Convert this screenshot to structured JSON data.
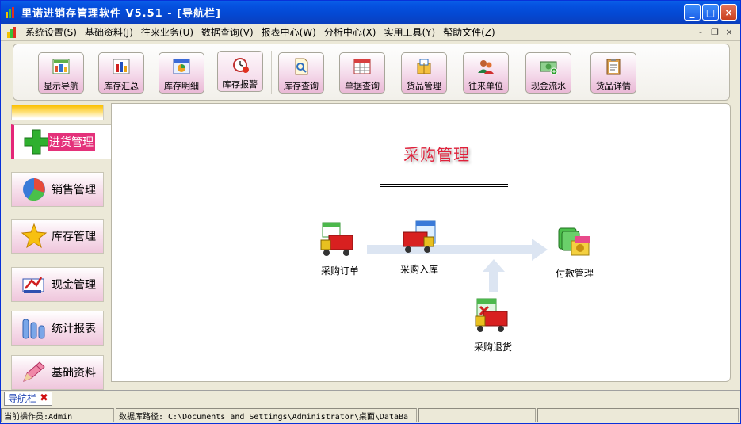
{
  "window": {
    "title": "里诺进销存管理软件 V5.51 - [导航栏]",
    "controls": {
      "minimize": "_",
      "maximize": "□",
      "close": "×"
    }
  },
  "menu": {
    "items": [
      "系统设置(S)",
      "基础资料(J)",
      "往来业务(U)",
      "数据查询(V)",
      "报表中心(W)",
      "分析中心(X)",
      "实用工具(Y)",
      "帮助文件(Z)"
    ],
    "mdi_controls": [
      "-",
      "❐",
      "×"
    ]
  },
  "toolbar": {
    "buttons": [
      {
        "label": "显示导航",
        "icon": "grid-chart-icon"
      },
      {
        "label": "库存汇总",
        "icon": "bar-chart-icon"
      },
      {
        "label": "库存明细",
        "icon": "pie-window-icon"
      },
      {
        "label": "库存报警",
        "icon": "alarm-clock-icon"
      },
      {
        "label": "库存查询",
        "icon": "search-doc-icon"
      },
      {
        "label": "单据查询",
        "icon": "table-icon"
      },
      {
        "label": "货品管理",
        "icon": "package-icon"
      },
      {
        "label": "往来单位",
        "icon": "people-icon"
      },
      {
        "label": "现金流水",
        "icon": "cash-icon"
      },
      {
        "label": "货品详情",
        "icon": "clipboard-icon"
      }
    ]
  },
  "sidebar": {
    "items": [
      {
        "label": "进货管理",
        "icon": "green-plus-icon"
      },
      {
        "label": "销售管理",
        "icon": "pie-chart-icon"
      },
      {
        "label": "库存管理",
        "icon": "star-icon"
      },
      {
        "label": "现金管理",
        "icon": "money-icon"
      },
      {
        "label": "统计报表",
        "icon": "column-chart-icon"
      },
      {
        "label": "基础资料",
        "icon": "pencil-icon"
      }
    ]
  },
  "main": {
    "title": "采购管理",
    "nodes": [
      {
        "label": "采购订单",
        "icon": "order-truck-icon"
      },
      {
        "label": "采购入库",
        "icon": "stock-in-truck-icon"
      },
      {
        "label": "付款管理",
        "icon": "payment-cash-icon"
      },
      {
        "label": "采购退货",
        "icon": "return-truck-icon"
      }
    ]
  },
  "navtab": {
    "label": "导航栏",
    "close": "✖"
  },
  "status": {
    "operator": "当前操作员:Admin",
    "db_path": "数据库路径: C:\\Documents and Settings\\Administrator\\桌面\\DataBa",
    "p3": "",
    "p4": ""
  },
  "colors": {
    "title_red": "#e0203a",
    "selected_tab": "#e4317a",
    "xp_blue": "#0551e0"
  }
}
